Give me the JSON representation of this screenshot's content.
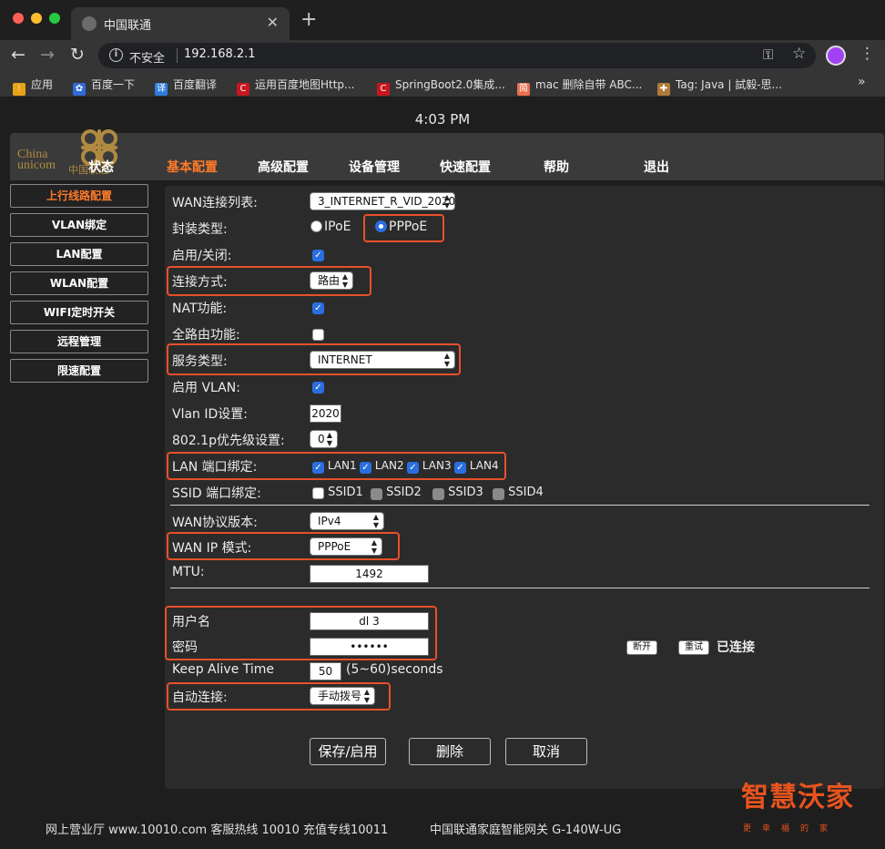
{
  "browser": {
    "tab_title": "中国联通",
    "security_label": "不安全",
    "url": "192.168.2.1",
    "bookmarks": [
      {
        "label": "应用",
        "icon": "apps-grid-icon",
        "color": "#e8a317"
      },
      {
        "label": "百度一下",
        "icon": "baidu-paw-icon",
        "color": "#2f6bd8"
      },
      {
        "label": "百度翻译",
        "icon": "baidu-translate-icon",
        "color": "#2f7de1"
      },
      {
        "label": "运用百度地图Http...",
        "icon": "csdn-c-icon",
        "color": "#c8161e"
      },
      {
        "label": "SpringBoot2.0集成...",
        "icon": "csdn-c-icon",
        "color": "#c8161e"
      },
      {
        "label": "mac 删除自带 ABC...",
        "icon": "jianshu-icon",
        "color": "#e9704f"
      },
      {
        "label": "Tag: Java | 試毅-思...",
        "icon": "tag-icon",
        "color": "#b07a3a"
      }
    ]
  },
  "header": {
    "clock": "4:03 PM",
    "logo_en_1": "China",
    "logo_en_2": "unicom",
    "logo_cn": "中国联通",
    "status_label": "状态",
    "nav": [
      "基本配置",
      "高级配置",
      "设备管理",
      "快速配置",
      "帮助",
      "退出"
    ]
  },
  "sidebar": {
    "items": [
      "上行线路配置",
      "VLAN绑定",
      "LAN配置",
      "WLAN配置",
      "WIFI定时开关",
      "远程管理",
      "限速配置"
    ]
  },
  "form": {
    "wan_list_label": "WAN连接列表:",
    "wan_list_value": "3_INTERNET_R_VID_2020",
    "encap_label": "封装类型:",
    "encap_ipoe": "IPoE",
    "encap_pppoe": "PPPoE",
    "enable_label": "启用/关闭:",
    "conn_mode_label": "连接方式:",
    "conn_mode_value": "路由",
    "nat_label": "NAT功能:",
    "full_route_label": "全路由功能:",
    "service_label": "服务类型:",
    "service_value": "INTERNET",
    "vlan_enable_label": "启用 VLAN:",
    "vlan_id_label": "Vlan ID设置:",
    "vlan_id_value": "2020",
    "priority_label": "802.1p优先级设置:",
    "priority_value": "0",
    "lan_bind_label": "LAN 端口绑定:",
    "lan_ports": [
      "LAN1",
      "LAN2",
      "LAN3",
      "LAN4"
    ],
    "ssid_bind_label": "SSID 端口绑定:",
    "ssids": [
      "SSID1",
      "SSID2",
      "SSID3",
      "SSID4"
    ],
    "wan_proto_label": "WAN协议版本:",
    "wan_proto_value": "IPv4",
    "wan_ip_mode_label": "WAN IP 模式:",
    "wan_ip_mode_value": "PPPoE",
    "mtu_label": "MTU:",
    "mtu_value": "1492",
    "username_label": "用户名",
    "username_value": "dl            3",
    "password_label": "密码",
    "password_value": "••••••",
    "disconnect_label": "断开",
    "retry_label": "重试",
    "status_text": "已连接",
    "keepalive_label": "Keep Alive Time",
    "keepalive_value": "50",
    "keepalive_hint": "(5~60)seconds",
    "autoconnect_label": "自动连接:",
    "autoconnect_value": "手动拨号",
    "save_label": "保存/启用",
    "delete_label": "删除",
    "cancel_label": "取消"
  },
  "footer": {
    "left": "网上营业厅 www.10010.com 客服热线 10010 充值专线10011",
    "right": "中国联通家庭智能网关 G-140W-UG",
    "brand": "智慧沃家",
    "brand_sub": "更幸福的家"
  },
  "colors": {
    "accent": "#ff7a2a",
    "highlight_box": "#e8502a",
    "checkbox": "#2a6ee0"
  }
}
